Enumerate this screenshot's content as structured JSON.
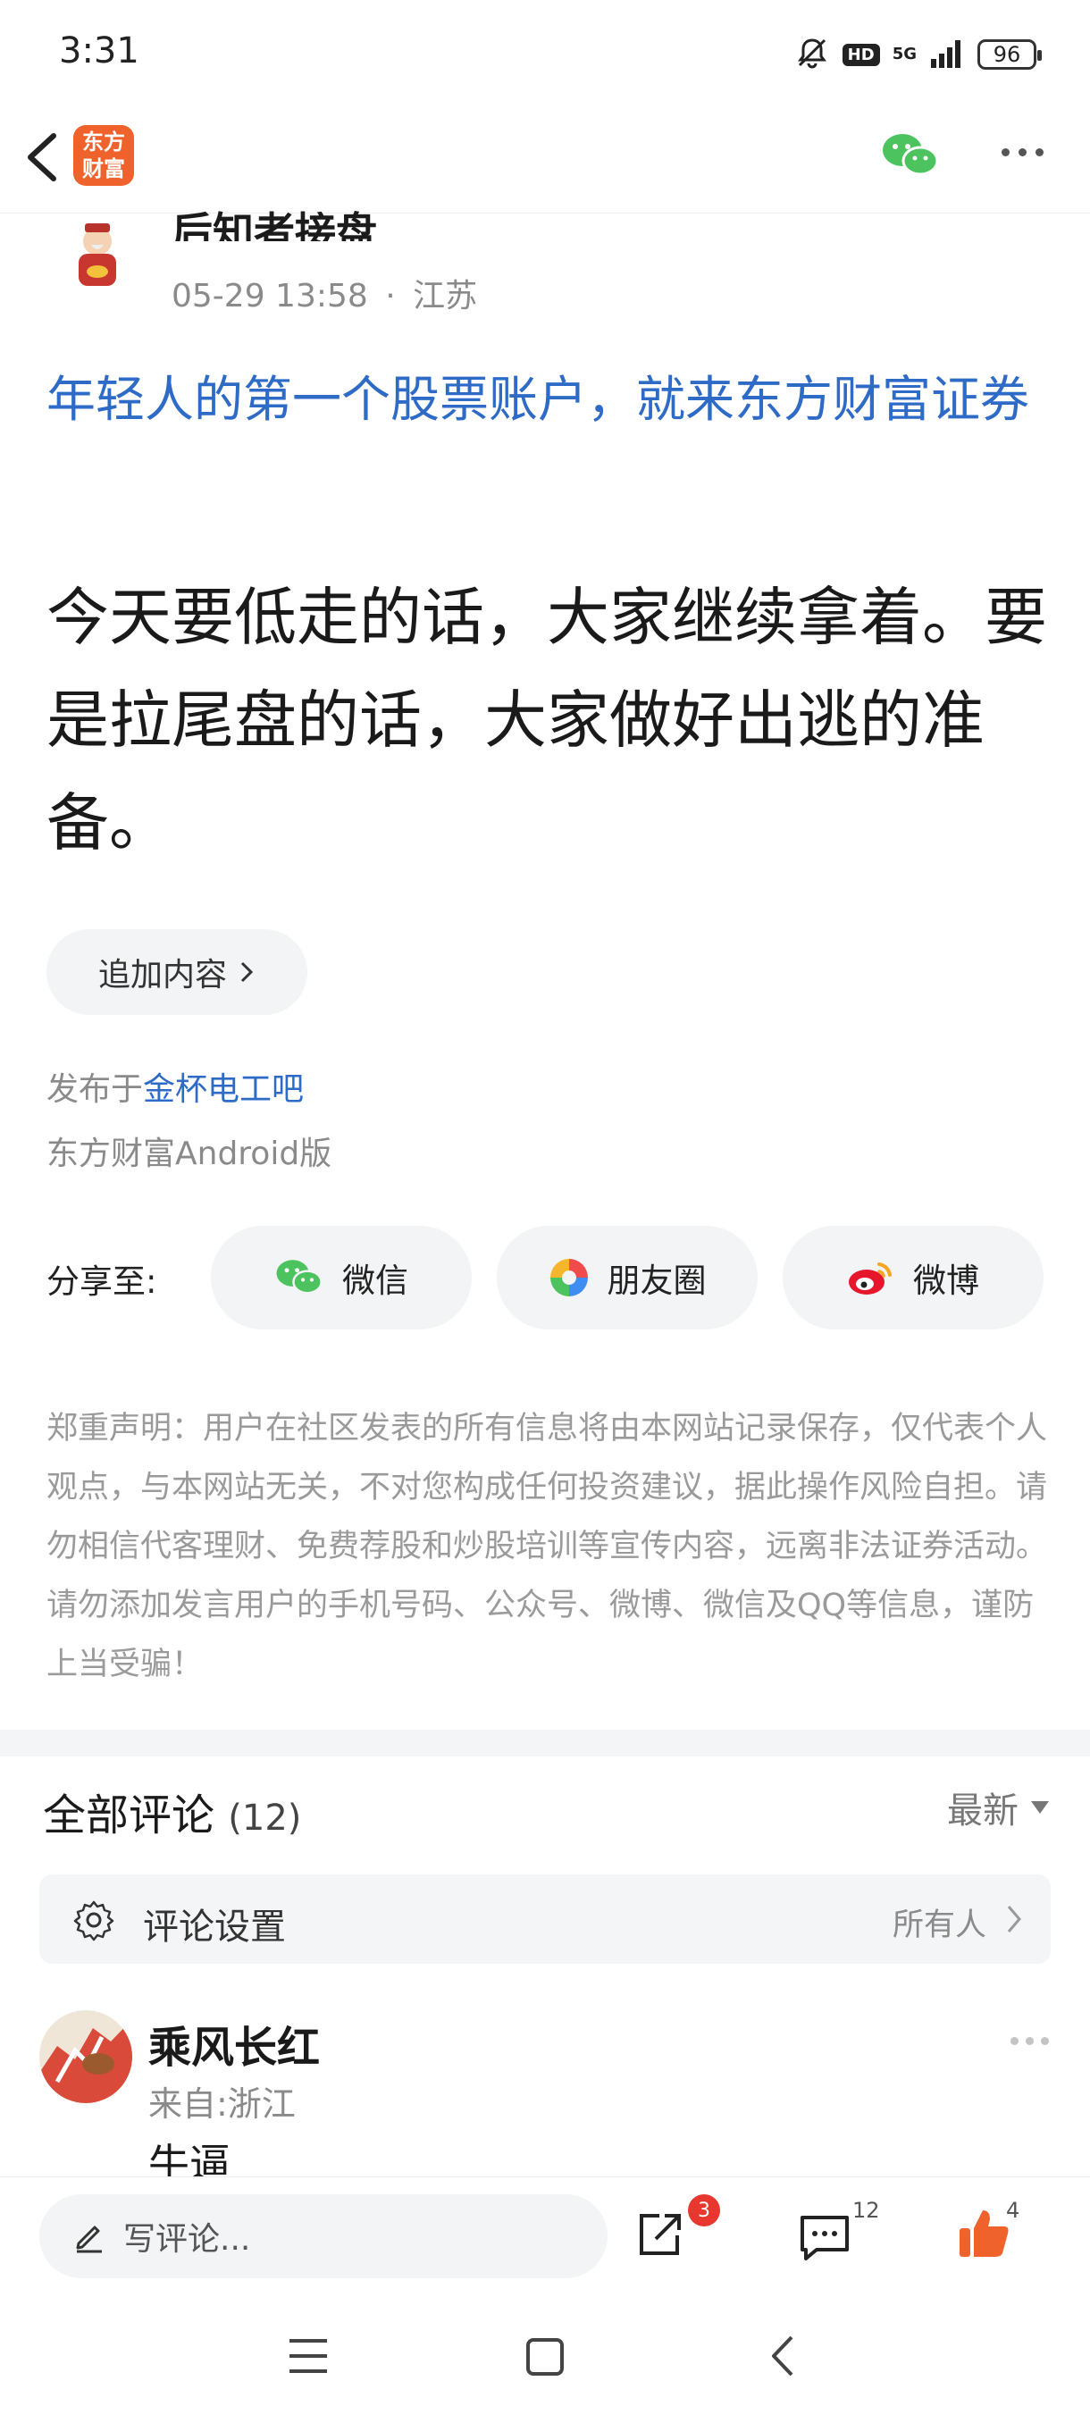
{
  "status_bar": {
    "time": "3:31",
    "hd": "HD",
    "network": "5G",
    "battery": "96"
  },
  "nav": {
    "logo_line1": "东方",
    "logo_line2": "财富"
  },
  "post": {
    "author": "后知者接盘",
    "date": "05-29 13:58",
    "separator": "·",
    "location": "江苏",
    "ad_title": "年轻人的第一个股票账户，就来东方财富证券",
    "body": "今天要低走的话，大家继续拿着。要是拉尾盘的话，大家做好出逃的准备。",
    "append_label": "追加内容",
    "published_prefix": "发布于",
    "forum_name": "金杯电工吧",
    "client": "东方财富Android版"
  },
  "share": {
    "label": "分享至:",
    "wechat": "微信",
    "moments": "朋友圈",
    "weibo": "微博"
  },
  "disclaimer": "郑重声明：用户在社区发表的所有信息将由本网站记录保存，仅代表个人观点，与本网站无关，不对您构成任何投资建议，据此操作风险自担。请勿相信代客理财、免费荐股和炒股培训等宣传内容，远离非法证券活动。请勿添加发言用户的手机号码、公众号、微博、微信及QQ等信息，谨防上当受骗！",
  "comments": {
    "title": "全部评论",
    "count": "(12)",
    "sort": "最新",
    "settings_label": "评论设置",
    "settings_value": "所有人",
    "items": [
      {
        "name": "乘风长红",
        "from": "来自:浙江",
        "text": "牛逼"
      }
    ]
  },
  "bottom_bar": {
    "placeholder": "写评论...",
    "share_badge": "3",
    "comment_count": "12",
    "like_count": "4"
  },
  "colors": {
    "brand": "#f0622b",
    "link": "#2e6bc6",
    "like": "#f0622b"
  }
}
